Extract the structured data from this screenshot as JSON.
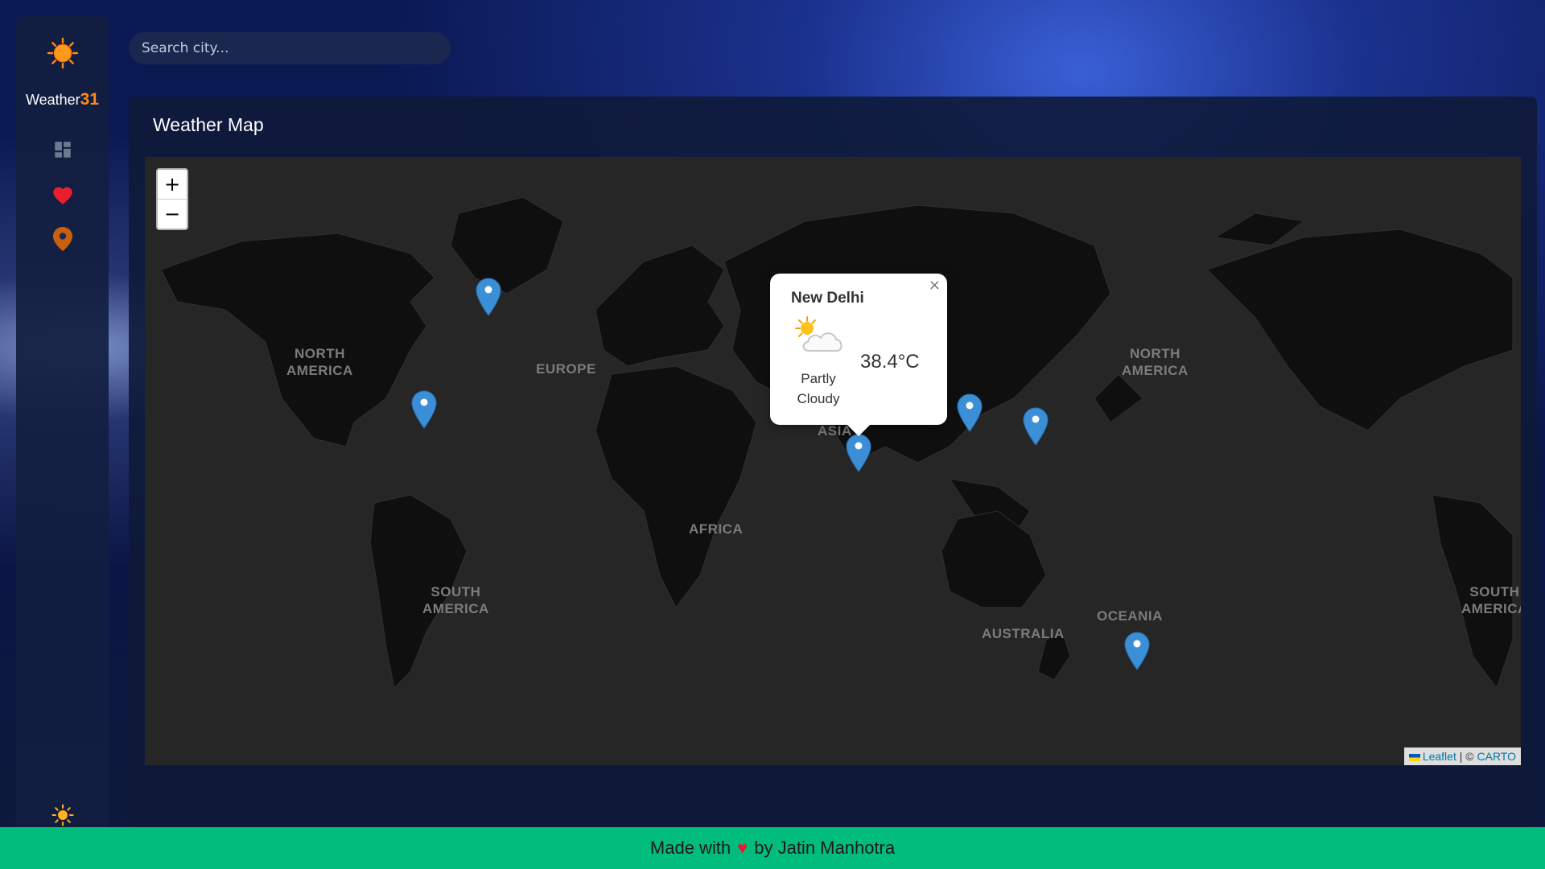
{
  "brand": {
    "name": "Weather",
    "number": "31",
    "logo_icon": "sun-icon"
  },
  "nav": [
    {
      "name": "dashboard",
      "icon": "dashboard-icon",
      "color": "#6f7a8e"
    },
    {
      "name": "favorites",
      "icon": "heart-icon",
      "color": "#e8202e"
    },
    {
      "name": "map",
      "icon": "map-pin-icon",
      "color": "#c8600f",
      "active": true
    }
  ],
  "theme_toggle": {
    "icon": "sun-icon",
    "color": "#ffb020"
  },
  "search": {
    "placeholder": "Search city..."
  },
  "panel": {
    "title": "Weather Map"
  },
  "map": {
    "zoom_in": "+",
    "zoom_out": "−",
    "labels": {
      "north_america_left": "NORTH\nAMERICA",
      "north_america_right": "NORTH\nAMERICA",
      "europe": "EUROPE",
      "asia": "ASIA",
      "africa": "AFRICA",
      "south_america_left": "SOUTH\nAMERICA",
      "south_america_right": "SOUTH\nAMERICA",
      "australia": "AUSTRALIA",
      "oceania": "OCEANIA"
    },
    "marker_color": "#3a8fd6",
    "markers": [
      "greenland-marker",
      "new-york-marker",
      "new-delhi-marker",
      "beijing-marker",
      "tokyo-marker",
      "wellington-marker"
    ],
    "popup": {
      "city": "New Delhi",
      "condition": "Partly Cloudy",
      "temperature": "38.4°C",
      "icon": "partly-cloudy-icon",
      "close": "×"
    },
    "attribution": {
      "leaflet": "Leaflet",
      "separator": "|",
      "copyright": "©",
      "carto": "CARTO"
    }
  },
  "footer": {
    "prefix": "Made with",
    "heart": "♥",
    "suffix": "by Jatin Manhotra",
    "background": "#00bd7e"
  }
}
